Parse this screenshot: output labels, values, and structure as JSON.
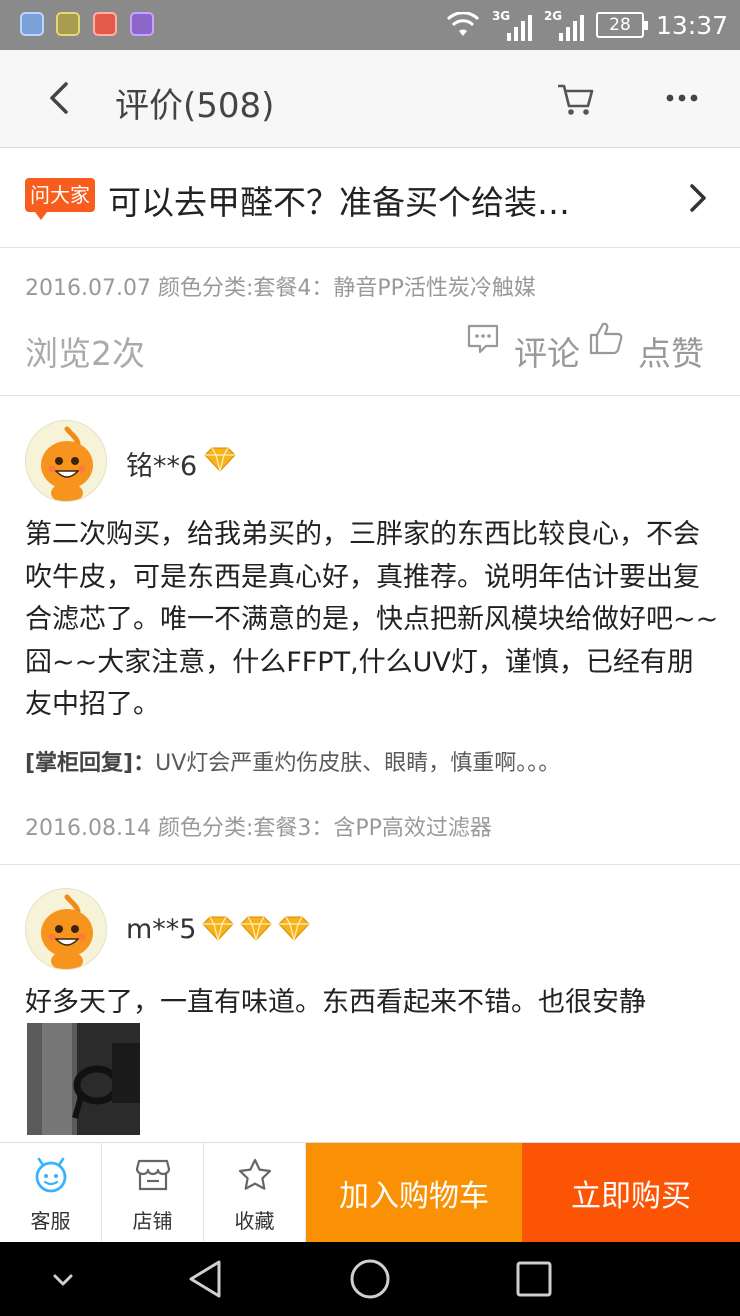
{
  "status_bar": {
    "signal_1_label": "3G",
    "signal_2_label": "2G",
    "battery": "28",
    "time": "13:37"
  },
  "header": {
    "title": "评价(508)",
    "icons": [
      "back-icon",
      "cart-icon",
      "more-icon"
    ]
  },
  "ask": {
    "badge": "问大家",
    "question": "可以去甲醛不？准备买个给装…"
  },
  "previous_review": {
    "meta": "2016.07.07 颜色分类:套餐4：静音PP活性炭冷触媒",
    "views": "浏览2次",
    "comment_label": "评论",
    "like_label": "点赞"
  },
  "reviews": [
    {
      "username": "铭**6",
      "gem_count": 1,
      "text": "第二次购买，给我弟买的，三胖家的东西比较良心，不会吹牛皮，可是东西是真心好，真推荐。说明年估计要出复合滤芯了。唯一不满意的是，快点把新风模块给做好吧~~囧~~大家注意，什么FFPT,什么UV灯，谨慎，已经有朋友中招了。",
      "reply_label": "[掌柜回复]：",
      "reply_text": "UV灯会严重灼伤皮肤、眼睛，慎重啊。。。",
      "meta": "2016.08.14 颜色分类:套餐3：含PP高效过滤器"
    },
    {
      "username": "m**5",
      "gem_count": 3,
      "text": "好多天了，一直有味道。东西看起来不错。也很安静"
    }
  ],
  "action_bar": {
    "service": "客服",
    "shop": "店铺",
    "favorite": "收藏",
    "add_to_cart": "加入购物车",
    "buy_now": "立即购买"
  },
  "colors": {
    "accent_orange": "#fa9104",
    "buy_red": "#fb5404",
    "ask_badge": "#f85d1e",
    "service_icon": "#3ab2ff",
    "gem": "#f5b21a"
  }
}
